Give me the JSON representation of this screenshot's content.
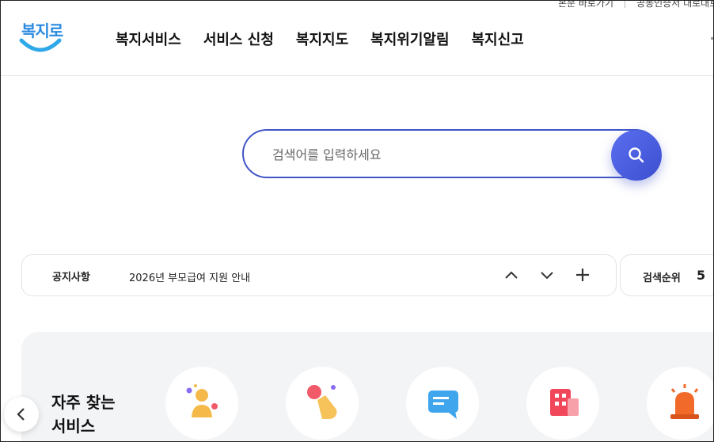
{
  "utility_links": [
    "본문 바로가기",
    "공동인증서 대로대로"
  ],
  "logo": {
    "text": "복지로"
  },
  "nav": [
    {
      "label": "복지서비스"
    },
    {
      "label": "서비스 신청"
    },
    {
      "label": "복지지도"
    },
    {
      "label": "복지위기알림"
    },
    {
      "label": "복지신고"
    }
  ],
  "search": {
    "placeholder": "검색어를 입력하세요",
    "value": ""
  },
  "notice": {
    "label": "공지사항",
    "text": "2026년 부모급여 지원 안내"
  },
  "rank": {
    "label": "검색순위",
    "number": "5"
  },
  "frequent": {
    "title_line1": "자주 찾는",
    "title_line2": "서비스"
  },
  "service_icons": [
    "people-icon",
    "touch-icon",
    "chat-icon",
    "building-icon",
    "alarm-icon"
  ],
  "colors": {
    "accent": "#3f55c8",
    "logo": "#2a8ae0"
  }
}
